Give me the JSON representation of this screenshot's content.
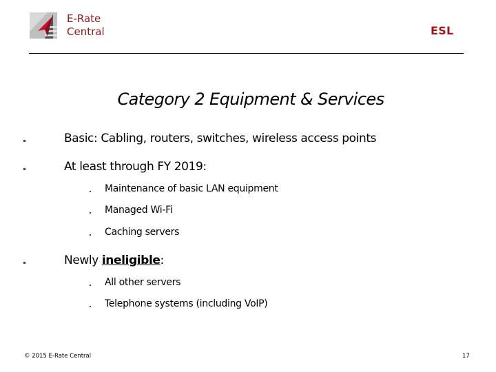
{
  "header": {
    "brand_line1": "E-Rate",
    "brand_line2": "Central",
    "right_label": "ESL",
    "logo_icon": "e-rate-central-logo-icon"
  },
  "colors": {
    "brand": "#8b1a1f",
    "bullet": "#3a3a6a"
  },
  "slide": {
    "title": "Category 2 Equipment & Services",
    "bullets": [
      {
        "text": "Basic:  Cabling, routers, switches, wireless access points",
        "children": []
      },
      {
        "text": "At least through FY 2019:",
        "children": [
          {
            "text": "Maintenance of basic LAN equipment"
          },
          {
            "text": "Managed Wi-Fi"
          },
          {
            "text": "Caching servers"
          }
        ]
      },
      {
        "text_prefix": "Newly ",
        "text_emphasis": "ineligible",
        "text_suffix": ":",
        "children": [
          {
            "text": "All other servers"
          },
          {
            "text": "Telephone systems (including VoIP)"
          }
        ]
      }
    ]
  },
  "footer": {
    "copyright": "© 2015 E-Rate Central",
    "page_number": "17"
  }
}
